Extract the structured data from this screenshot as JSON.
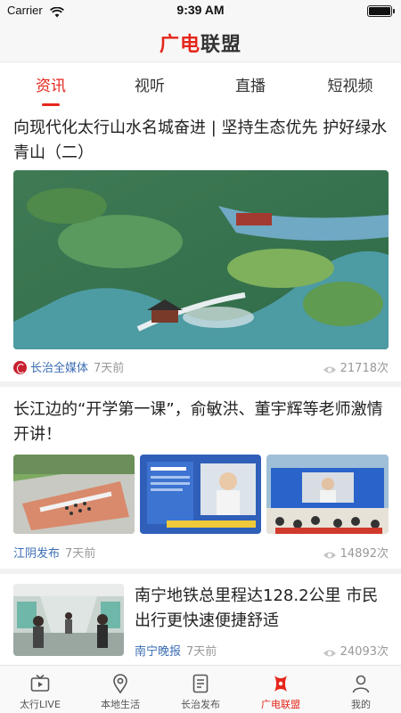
{
  "status_bar": {
    "carrier": "Carrier",
    "time": "9:39 AM"
  },
  "header": {
    "logo_red": "广电",
    "logo_dark": "联盟"
  },
  "tabs": [
    {
      "label": "资讯",
      "active": true
    },
    {
      "label": "视听",
      "active": false
    },
    {
      "label": "直播",
      "active": false
    },
    {
      "label": "短视频",
      "active": false
    }
  ],
  "articles": [
    {
      "title": "向现代化太行山水名城奋进 | 坚持生态优先 护好绿水青山（二）",
      "source": "长治全媒体",
      "time": "7天前",
      "views": "21718次",
      "image": "aerial-park-lake-photo"
    },
    {
      "title": "长江边的“开学第一课”，俞敏洪、董宇辉等老师激情开讲！",
      "source": "江阴发布",
      "time": "7天前",
      "views": "14892次",
      "images": [
        "school-field-aerial-photo",
        "stage-screen-speaker-photo",
        "outdoor-stage-audience-photo"
      ]
    },
    {
      "title": "南宁地铁总里程达128.2公里 市民出行更快速便捷舒适",
      "source": "南宁晚报",
      "time": "7天前",
      "views": "24093次",
      "image": "metro-carriage-interior-photo"
    }
  ],
  "tabbar": [
    {
      "label": "太行LIVE",
      "icon": "tv-icon",
      "active": false
    },
    {
      "label": "本地生活",
      "icon": "location-pin-icon",
      "active": false
    },
    {
      "label": "长治发布",
      "icon": "document-list-icon",
      "active": false
    },
    {
      "label": "广电联盟",
      "icon": "alliance-x-icon",
      "active": true
    },
    {
      "label": "我的",
      "icon": "person-icon",
      "active": false
    }
  ],
  "colors": {
    "accent": "#e5261b",
    "source_link": "#3b6db3",
    "meta_gray": "#999999"
  }
}
